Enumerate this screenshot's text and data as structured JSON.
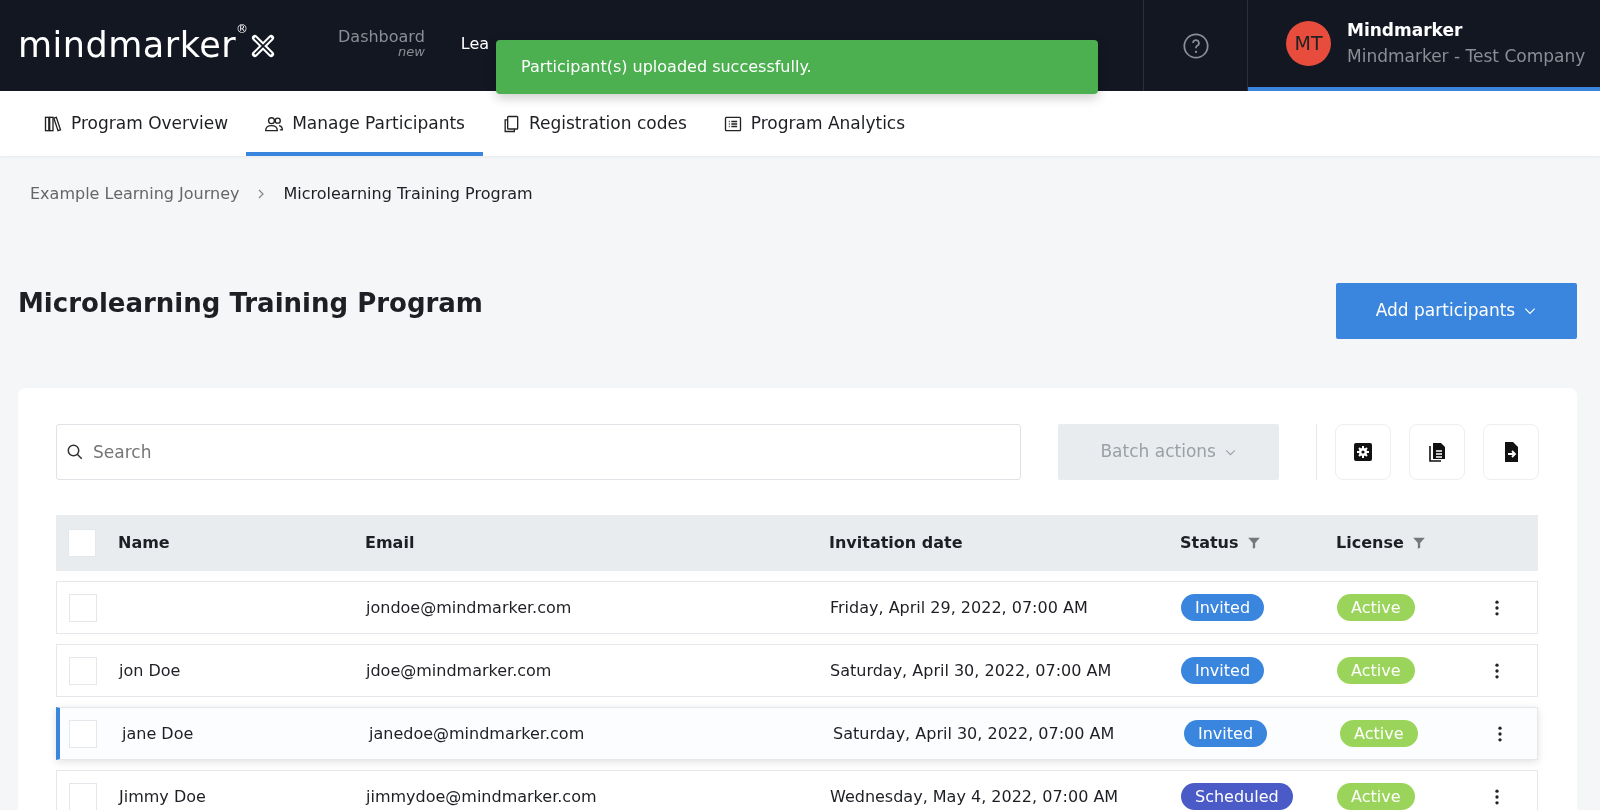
{
  "topbar": {
    "logo": "mindmarker",
    "logo_mark": "®",
    "nav": [
      {
        "label": "Dashboard",
        "sub": "new",
        "selected": false
      },
      {
        "label": "Lea",
        "selected": true
      }
    ],
    "user": {
      "initials": "MT",
      "name": "Mindmarker",
      "company": "Mindmarker - Test Company"
    }
  },
  "toast": {
    "message": "Participant(s) uploaded successfully."
  },
  "tabs": [
    {
      "label": "Program Overview",
      "selected": false
    },
    {
      "label": "Manage Participants",
      "selected": true
    },
    {
      "label": "Registration codes",
      "selected": false
    },
    {
      "label": "Program Analytics",
      "selected": false
    }
  ],
  "breadcrumb": [
    "Example Learning Journey",
    "Microlearning Training Program"
  ],
  "title": "Microlearning Training Program",
  "add_button": "Add participants",
  "search": {
    "placeholder": "Search"
  },
  "batch_button": {
    "label": "Batch actions",
    "disabled": true
  },
  "table": {
    "select_all": {
      "checked": false
    },
    "columns": [
      {
        "label": "Name",
        "filter": false
      },
      {
        "label": "Email",
        "filter": false
      },
      {
        "label": "Invitation date",
        "filter": false
      },
      {
        "label": "Status",
        "filter": true
      },
      {
        "label": "License",
        "filter": true
      }
    ],
    "rows": [
      {
        "name": "",
        "email": "jondoe@mindmarker.com",
        "date": "Friday, April 29, 2022, 07:00 AM",
        "status": "Invited",
        "kind": "invited",
        "license": "Active",
        "checked": false,
        "highlighted": false
      },
      {
        "name": "jon Doe",
        "email": "jdoe@mindmarker.com",
        "date": "Saturday, April 30, 2022, 07:00 AM",
        "status": "Invited",
        "kind": "invited",
        "license": "Active",
        "checked": false,
        "highlighted": false
      },
      {
        "name": "jane Doe",
        "email": "janedoe@mindmarker.com",
        "date": "Saturday, April 30, 2022, 07:00 AM",
        "status": "Invited",
        "kind": "invited",
        "license": "Active",
        "checked": false,
        "highlighted": true
      },
      {
        "name": "Jimmy Doe",
        "email": "jimmydoe@mindmarker.com",
        "date": "Wednesday, May 4, 2022, 07:00 AM",
        "status": "Scheduled",
        "kind": "scheduled",
        "license": "Active",
        "checked": false,
        "highlighted": false
      }
    ]
  }
}
